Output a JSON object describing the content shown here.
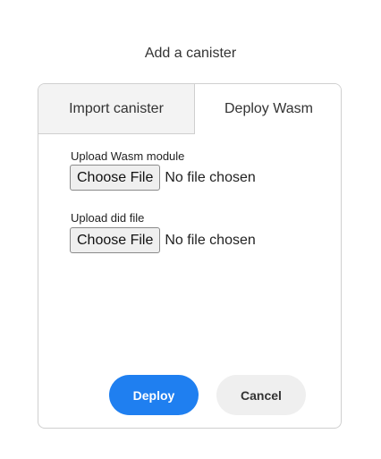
{
  "dialog": {
    "title": "Add a canister"
  },
  "tabs": [
    {
      "label": "Import canister",
      "active": false
    },
    {
      "label": "Deploy Wasm",
      "active": true
    }
  ],
  "fields": {
    "wasm": {
      "label": "Upload Wasm module",
      "button_label": "Choose File",
      "status": "No file chosen"
    },
    "did": {
      "label": "Upload did file",
      "button_label": "Choose File",
      "status": "No file chosen"
    }
  },
  "actions": {
    "deploy_label": "Deploy",
    "cancel_label": "Cancel"
  },
  "colors": {
    "accent": "#1f7ff0",
    "tab_inactive_bg": "#f3f3f3",
    "cancel_bg": "#efefef"
  }
}
